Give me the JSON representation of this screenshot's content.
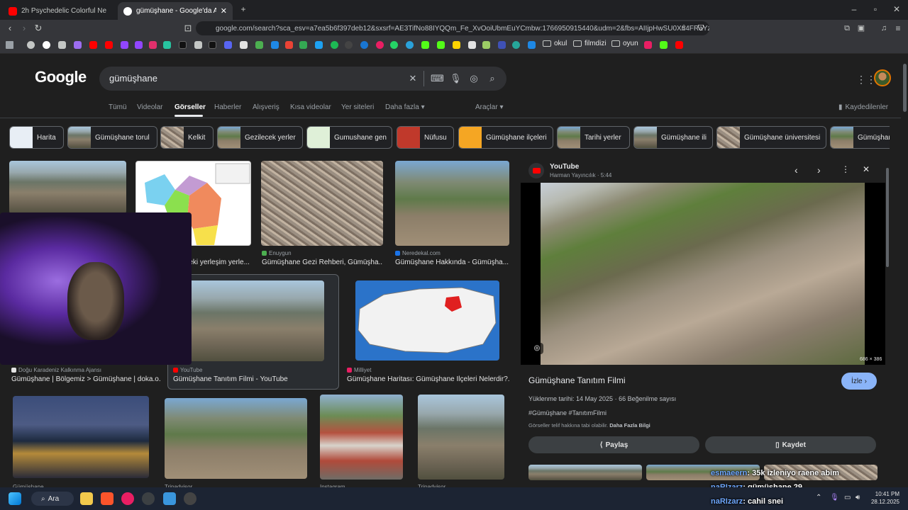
{
  "tabs": [
    {
      "title": "2h Psychedelic Colorful Neon Backgr..."
    },
    {
      "title": "gümüşhane - Google'da Ara"
    }
  ],
  "omnibox": {
    "url": "google.com/search?sca_esv=a7ea5b6f397deb12&sxsrf=AE3TifNo88IYQQm_Fe_XvOoiUbmEuYCmbw:1766950915440&udm=2&fbs=AIIjpHwSU0Xn4FRaYz..."
  },
  "bookmarks": [
    "okul",
    "filmdizi",
    "oyun"
  ],
  "google": {
    "logo": "Google",
    "query": "gümüşhane"
  },
  "nav": {
    "tabs": [
      "Tümü",
      "Videolar",
      "Görseller",
      "Haberler",
      "Alışveriş",
      "Kısa videolar",
      "Yer siteleri",
      "Daha fazla"
    ],
    "tools": "Araçlar",
    "saved": "Kaydedilenler"
  },
  "chips": [
    "Harita",
    "Gümüşhane torul",
    "Kelkit",
    "Gezilecek yerler",
    "Gumushane gen",
    "Nüfusu",
    "Gümüşhane ilçeleri",
    "Tarihi yerler",
    "Gümüşhane ili",
    "Gümüşhane üniversitesi",
    "Gümüşhar"
  ],
  "results": [
    {
      "source": "",
      "title": "...eki yerleşim yerle..."
    },
    {
      "source": "Enuygun",
      "title": "Gümüşhane Gezi Rehberi, Gümüşha..."
    },
    {
      "source": "Neredekal.com",
      "title": "Gümüşhane Hakkında - Gümüşha..."
    },
    {
      "source": "Doğu Karadeniz Kalkınma Ajansı",
      "title": "Gümüşhane | Bölgemiz > Gümüşhane | doka.o..."
    },
    {
      "source": "YouTube",
      "title": "Gümüşhane Tanıtım Filmi - YouTube"
    },
    {
      "source": "Milliyet",
      "title": "Gümüşhane Haritası: Gümüşhane İlçeleri Nelerdir?..."
    },
    {
      "source": "Gümüşhane",
      "title": ""
    },
    {
      "source": "Tripadvisor",
      "title": ""
    },
    {
      "source": "Instagram",
      "title": ""
    },
    {
      "source": "Tripadvisor",
      "title": ""
    }
  ],
  "panel": {
    "source": "YouTube",
    "meta": "Harman Yayıncılık · 5:44",
    "dims": "686 × 386",
    "title": "Gümüşhane Tanıtım Filmi",
    "watch": "İzle",
    "uploaded": "Yüklenme tarihi: 14 May 2025 · 66 Beğenilme sayısı",
    "tags": "#Gümüşhane #TanıtımFilmi",
    "copyright": "Görseller telif hakkına tabi olabilir.",
    "more": "Daha Fazla Bilgi",
    "share": "Paylaş",
    "save": "Kaydet"
  },
  "chat": [
    {
      "user": "esmaeern",
      "msg": ": 35k izleniyo raene abim"
    },
    {
      "user": "naRIzarz",
      "msg": ": gümüşhane 29"
    },
    {
      "user": "naRIzarz",
      "msg": ": cahil snei"
    }
  ],
  "taskbar": {
    "search": "Ara",
    "time": "10:41 PM",
    "date": "28.12.2025"
  },
  "colors": {
    "accent": "#8ab4f8",
    "youtube": "#ff0000",
    "chat_user": "#6fa8ff"
  }
}
